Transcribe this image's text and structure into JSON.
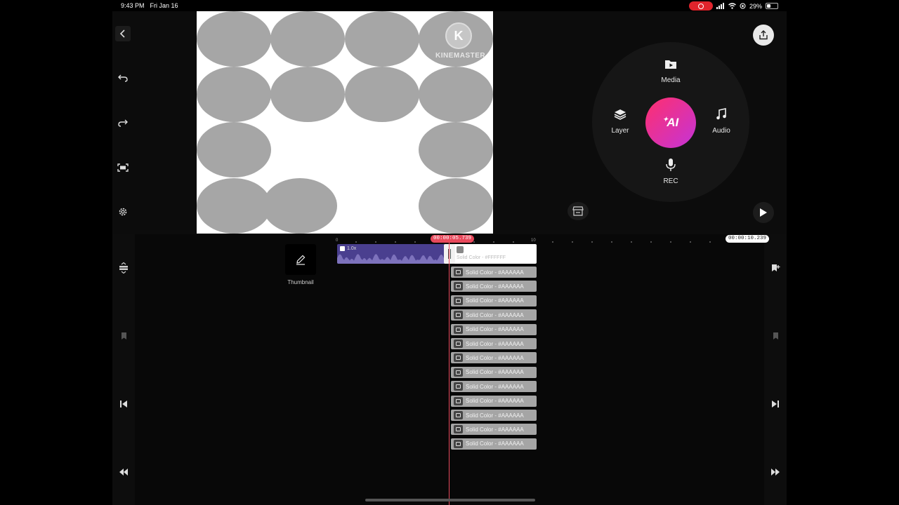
{
  "status_bar": {
    "time": "9:43 PM",
    "date": "Fri Jan 16",
    "battery": "29%",
    "battery_level": 0.29
  },
  "preview": {
    "watermark_text": "KINEMASTER",
    "watermark_letter": "K",
    "canvas_color": "#FFFFFF",
    "oval_color": "#A6A6A6"
  },
  "wheel": {
    "media_label": "Media",
    "layer_label": "Layer",
    "audio_label": "Audio",
    "rec_label": "REC",
    "ai_label": "AI"
  },
  "timeline": {
    "current_time": "00:00:05.739",
    "total_time": "00:00:10.239",
    "ruler_start": "0",
    "ruler_mark": "10",
    "thumbnail_label": "Thumbnail",
    "video_clip_speed": "1.0x",
    "white_clip_label": "Solid Color - #FFFFFF",
    "layer_clips": [
      "Solid Color - #AAAAAA",
      "Solid Color - #AAAAAA",
      "Solid Color - #AAAAAA",
      "Solid Color - #AAAAAA",
      "Solid Color - #AAAAAA",
      "Solid Color - #AAAAAA",
      "Solid Color - #AAAAAA",
      "Solid Color - #AAAAAA",
      "Solid Color - #AAAAAA",
      "Solid Color - #AAAAAA",
      "Solid Color - #AAAAAA",
      "Solid Color - #AAAAAA",
      "Solid Color - #AAAAAA"
    ]
  },
  "colors": {
    "playhead": "#E8495C",
    "video_clip": "#4A3F8F",
    "ai_gradient_start": "#FF2F6D",
    "ai_gradient_end": "#C434D8"
  }
}
